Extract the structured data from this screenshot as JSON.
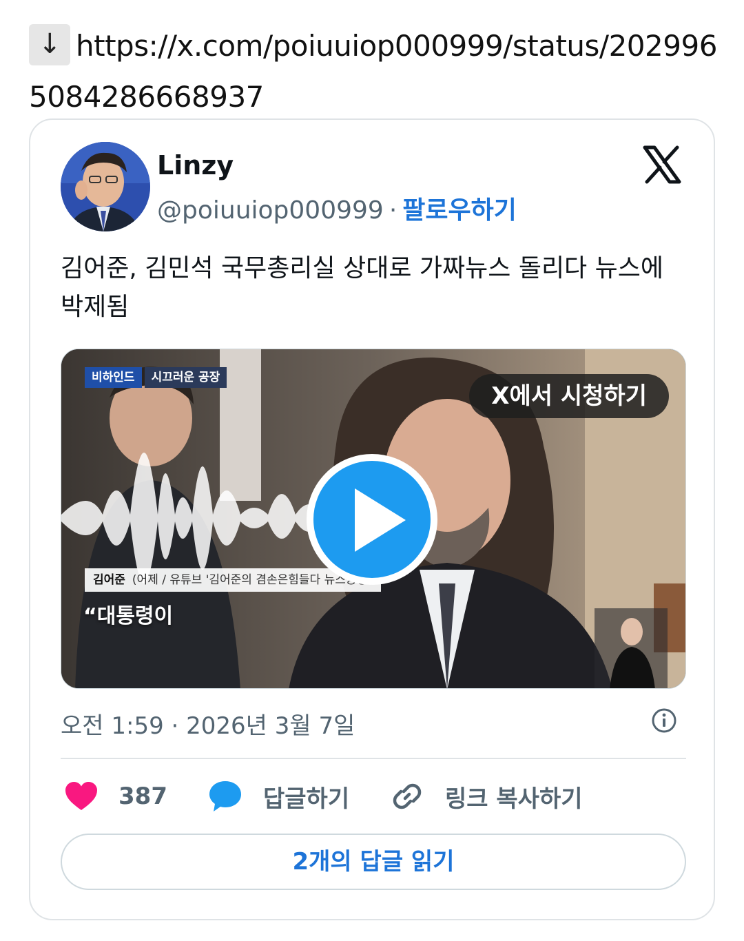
{
  "share": {
    "arrow_glyph": "↓",
    "url": "https://x.com/poiuuiop000999/status/2029965084286668937"
  },
  "tweet": {
    "display_name": "Linzy",
    "handle": "@poiuuiop000999",
    "separator": "·",
    "follow_label": "팔로우하기",
    "text": "김어준,  김민석 국무총리실 상대로 가짜뉴스 돌리다 뉴스에 박제됨",
    "timestamp": "오전 1:59 · 2026년 3월 7일",
    "likes": "387",
    "reply_label": "답글하기",
    "copy_link_label": "링크 복사하기",
    "read_replies_label": "2개의 답글 읽기"
  },
  "media": {
    "watch_label": "X에서 시청하기",
    "news_tag_1": "비하인드",
    "news_tag_2": "시끄러운 공장",
    "caption_name": "김어준",
    "caption_detail": "(어제 / 유튜브 '김어준의 겸손은힘들다 뉴스공장')",
    "quote": "“대통령이"
  },
  "colors": {
    "accent": "#1d9bf0",
    "link": "#1d74d8",
    "like": "#f91880",
    "muted": "#536471"
  },
  "icons": {
    "platform": "x-logo-icon",
    "like": "heart-icon",
    "reply": "speech-bubble-icon",
    "link": "link-icon",
    "info": "info-icon",
    "play": "play-icon"
  }
}
